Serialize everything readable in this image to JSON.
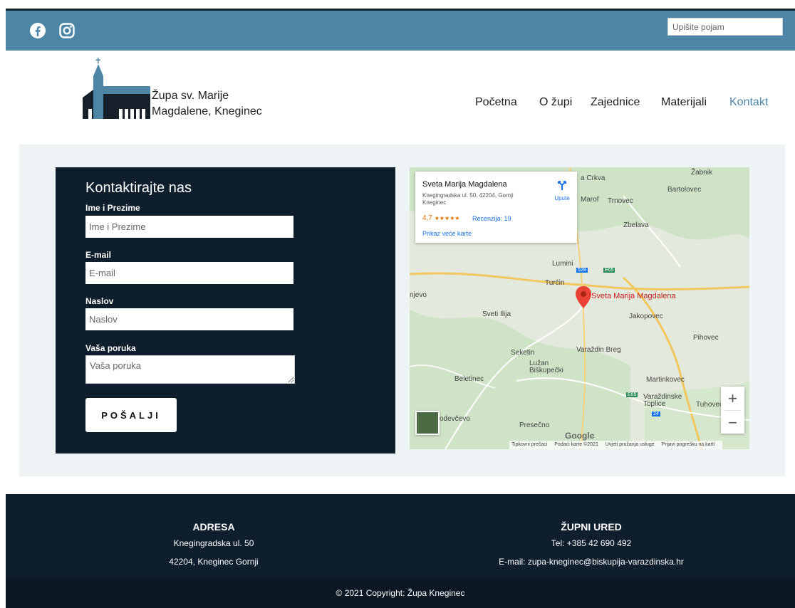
{
  "topbar": {
    "search_placeholder": "Upišite pojam",
    "social": [
      "facebook-icon",
      "instagram-icon"
    ],
    "color": "#4d85a6"
  },
  "brand": {
    "line1": "Župa sv. Marije",
    "line2": "Magdalene, Kneginec"
  },
  "nav": {
    "items": [
      "Početna",
      "O župi",
      "Zajednice",
      "Materijali",
      "Kontakt"
    ],
    "active": "Kontakt"
  },
  "contact_form": {
    "title": "Kontaktirajte nas",
    "fields": [
      {
        "label": "Ime i Prezime",
        "placeholder": "Ime i Prezime"
      },
      {
        "label": "E-mail",
        "placeholder": "E-mail"
      },
      {
        "label": "Naslov",
        "placeholder": "Naslov"
      },
      {
        "label": "Vaša poruka",
        "placeholder": "Vaša poruka"
      }
    ],
    "submit_label": "POŠALJI"
  },
  "map": {
    "place_title": "Sveta Marija Magdalena",
    "place_address": "Knegingradska ul. 50, 42204, Gornji Kneginec",
    "rating": "4,7",
    "stars": "★★★★★",
    "reviews": "Recenzija: 19",
    "bigger_map": "Prikaz veće karte",
    "directions": "Upute",
    "marker_label": "Sveta Marija Magdalena",
    "places": [
      "a Crkva",
      "Žabnik",
      "Bartolovec",
      "Marof",
      "Trnovec",
      "Zbelava",
      "Lumini",
      "Turčin",
      "Jakopovec",
      "Sveti Ilija",
      "Pihovec",
      "Seketin",
      "Varaždin Breg",
      "Lužan Biškupečki",
      "Beletinec",
      "Martinkovec",
      "Varaždinske Toplice",
      "Tuhovec",
      "Presečno",
      "odevčevo",
      "njevo"
    ],
    "road_labels": [
      "528",
      "E65",
      "E65",
      "24"
    ],
    "zoom_in": "+",
    "zoom_out": "−",
    "google": "Google",
    "attribution": [
      "Tipkovni prečaci",
      "Podaci karte ©2021",
      "Uvjeti pružanja usluge",
      "Prijavi pogrešku na karti"
    ]
  },
  "footer": {
    "address_heading": "ADRESA",
    "address_line1": "Knegingradska ul. 50",
    "address_line2": "42204, Kneginec Gornji",
    "office_heading": "ŽUPNI URED",
    "office_tel": "Tel: +385 42 690 492",
    "office_email": "E-mail: zupa-kneginec@biskupija-varazdinska.hr",
    "copyright": "© 2021 Copyright: Župa Kneginec"
  }
}
